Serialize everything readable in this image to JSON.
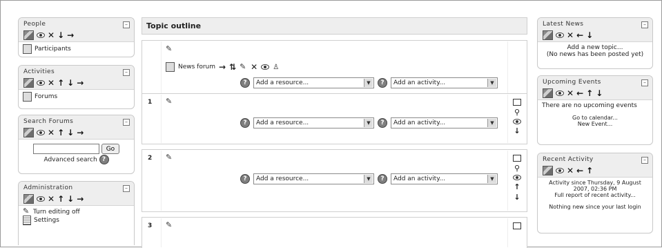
{
  "people": {
    "title": "People",
    "collapse": "–",
    "arrows": [
      "↓",
      "→"
    ],
    "items": [
      {
        "label": "Participants",
        "icon": "people-icon"
      }
    ]
  },
  "activities": {
    "title": "Activities",
    "collapse": "–",
    "arrows": [
      "↑",
      "↓",
      "→"
    ],
    "items": [
      {
        "label": "Forums",
        "icon": "forum-icon"
      }
    ]
  },
  "search_forums": {
    "title": "Search Forums",
    "collapse": "–",
    "arrows": [
      "↑",
      "↓",
      "→"
    ],
    "input_value": "",
    "go_label": "Go",
    "advanced_label": "Advanced search",
    "help": "?"
  },
  "administration": {
    "title": "Administration",
    "collapse": "–",
    "arrows": [
      "↑",
      "↓",
      "→"
    ],
    "items": [
      {
        "label": "Turn editing off",
        "icon": "pencil-icon"
      },
      {
        "label": "Settings",
        "icon": "document-icon"
      }
    ]
  },
  "main": {
    "title": "Topic outline",
    "news_forum": "News forum",
    "resource_placeholder": "Add a resource...",
    "activity_placeholder": "Add an activity...",
    "help": "?",
    "sections": [
      {
        "number": ""
      },
      {
        "number": "1"
      },
      {
        "number": "2"
      },
      {
        "number": "3"
      }
    ]
  },
  "latest_news": {
    "title": "Latest News",
    "collapse": "–",
    "arrows": [
      "←",
      "↓"
    ],
    "add_topic": "Add a new topic...",
    "no_news": "(No news has been posted yet)"
  },
  "upcoming_events": {
    "title": "Upcoming Events",
    "collapse": "–",
    "arrows": [
      "←",
      "↑",
      "↓"
    ],
    "no_events": "There are no upcoming events",
    "go_calendar": "Go to calendar...",
    "new_event": "New Event..."
  },
  "recent_activity": {
    "title": "Recent Activity",
    "collapse": "–",
    "arrows": [
      "←",
      "↑"
    ],
    "since": "Activity since Thursday, 9 August 2007, 02:36 PM",
    "full_report": "Full report of recent activity...",
    "nothing_new": "Nothing new since your last login"
  },
  "icons": {
    "move_label": "✎",
    "delete": "✕",
    "close": "✕",
    "colors": {
      "header_bg": "#eeeeee",
      "border": "#c8c8c8"
    }
  }
}
